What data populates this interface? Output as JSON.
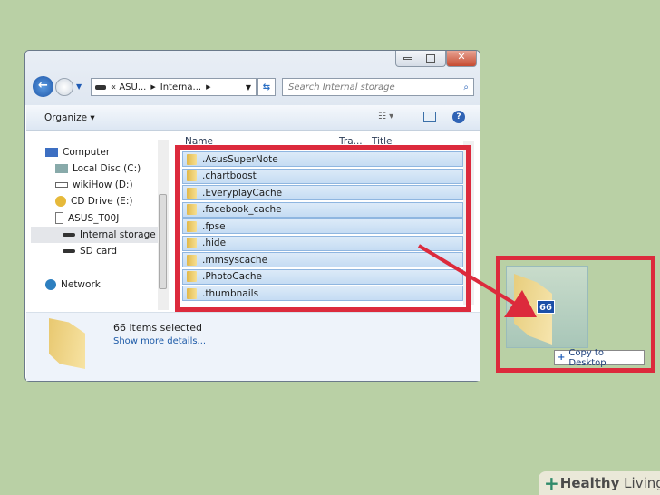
{
  "window": {
    "breadcrumb": [
      "«",
      "ASU...",
      "Interna..."
    ],
    "search_placeholder": "Search Internal storage",
    "organize_label": "Organize",
    "columns": [
      "Name",
      "Tra...",
      "Title"
    ],
    "sidebar": [
      {
        "label": "Computer",
        "icon": "computer-icon"
      },
      {
        "label": "Local Disc (C:)",
        "icon": "hard-drive-icon"
      },
      {
        "label": "wikiHow (D:)",
        "icon": "drive-icon"
      },
      {
        "label": "CD Drive (E:)",
        "icon": "cd-drive-icon"
      },
      {
        "label": "ASUS_T00J",
        "icon": "phone-icon"
      },
      {
        "label": "Internal storage",
        "icon": "storage-icon"
      },
      {
        "label": "SD card",
        "icon": "storage-icon"
      },
      {
        "label": "Network",
        "icon": "network-icon"
      }
    ],
    "files": [
      ".AsusSuperNote",
      ".chartboost",
      ".EveryplayCache",
      ".facebook_cache",
      ".fpse",
      ".hide",
      ".mmsyscache",
      ".PhotoCache",
      ".thumbnails"
    ],
    "status": {
      "count_text": "66 items selected",
      "details_link": "Show more details..."
    }
  },
  "drag": {
    "badge": "66",
    "tooltip": "Copy to Desktop"
  },
  "watermark": {
    "brand_bold": "Healthy",
    "brand_light": "Living"
  },
  "colors": {
    "highlight": "#dc2a3c",
    "background": "#b9d0a5",
    "selection": "#c5dcf3"
  }
}
